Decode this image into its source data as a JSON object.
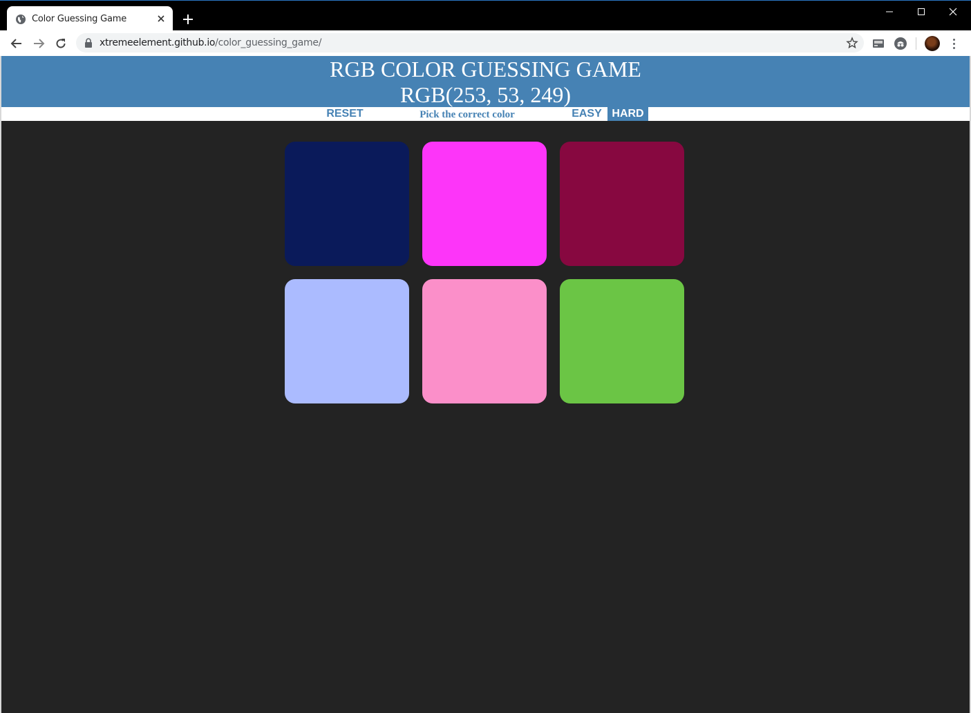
{
  "browser": {
    "tab": {
      "title": "Color Guessing Game"
    },
    "url": {
      "host": "xtremeelement.github.io",
      "path": "/color_guessing_game/"
    }
  },
  "game": {
    "title": "RGB COLOR GUESSING GAME",
    "target_rgb": "RGB(253, 53, 249)",
    "reset_label": "RESET",
    "message": "Pick the correct color",
    "easy_label": "EASY",
    "hard_label": "HARD",
    "selected_mode": "HARD",
    "squares": [
      {
        "color": "#0a1a5a"
      },
      {
        "color": "#fd35f9"
      },
      {
        "color": "#870840"
      },
      {
        "color": "#abbbff"
      },
      {
        "color": "#fb8fc9"
      },
      {
        "color": "#6bc545"
      }
    ]
  },
  "colors": {
    "header_bg": "#4682b4",
    "page_bg": "#232323",
    "accent": "#4682b4"
  }
}
